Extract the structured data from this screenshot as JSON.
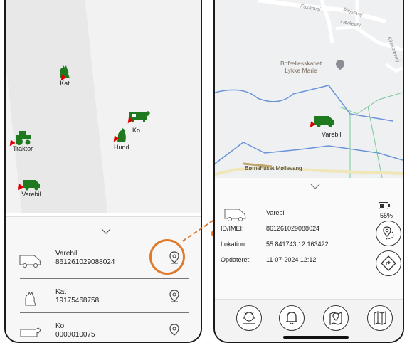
{
  "left_map": {
    "animals": [
      {
        "name": "Kat"
      },
      {
        "name": "Ko"
      },
      {
        "name": "Hund"
      },
      {
        "name": "Traktor"
      },
      {
        "name": "Varebil"
      }
    ]
  },
  "left_list": {
    "items": [
      {
        "name": "Varebil",
        "imei": "861261029088024"
      },
      {
        "name": "Kat",
        "imei": "19175468758"
      },
      {
        "name": "Ko",
        "imei": "0000010075"
      }
    ]
  },
  "right_map": {
    "streets": [
      "Fasanvej",
      "Mejsevej",
      "Lærkevej",
      "Kirsebærvej"
    ],
    "poi_label_1": "Bofællesskabet",
    "poi_label_2": "Lykke Marie",
    "vehicle_label": "Varebil",
    "school_label": "Børnehuset Møllevang"
  },
  "detail": {
    "name": "Varebil",
    "labels": {
      "id": "ID/IMEI:",
      "location": "Lokation:",
      "updated": "Opdateret:"
    },
    "id": "861261029088024",
    "location": "55.841743,12.163422",
    "updated": "11-07-2024 12:12",
    "battery": "55%"
  },
  "colors": {
    "accent": "#e07a2a",
    "green": "#1f7a1f",
    "red_marker": "#dd0000"
  }
}
